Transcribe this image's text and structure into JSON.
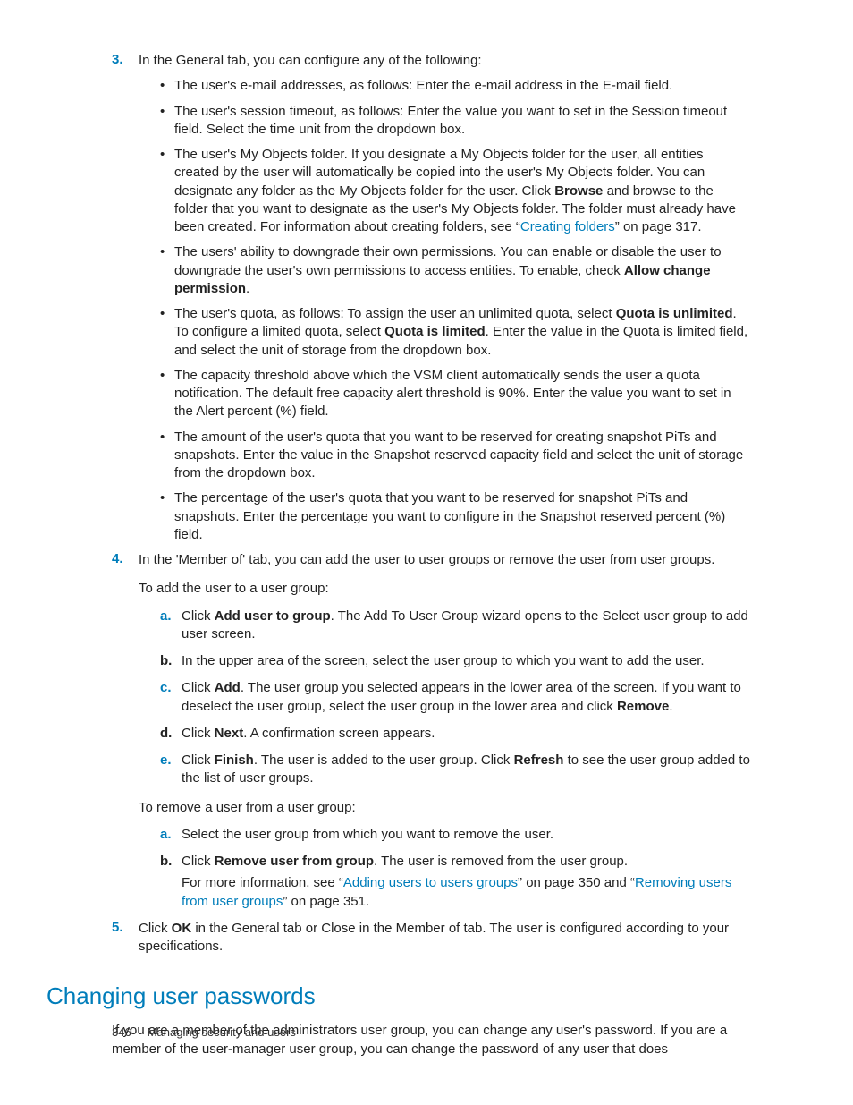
{
  "step3": {
    "num": "3.",
    "intro": "In the General tab, you can configure any of the following:",
    "bullets": {
      "b1": "The user's e-mail addresses, as follows: Enter the e-mail address in the E-mail field.",
      "b2": "The user's session timeout, as follows: Enter the value you want to set in the Session timeout field. Select the time unit from the dropdown box.",
      "b3_pre": "The user's My Objects folder. If you designate a My Objects folder for the user, all entities created by the user will automatically be copied into the user's My Objects folder. You can designate any folder as the My Objects folder for the user. Click ",
      "b3_bold1": "Browse",
      "b3_mid": " and browse to the folder that you want to designate as the user's My Objects folder. The folder must already have been created. For information about creating folders, see “",
      "b3_link": "Creating folders",
      "b3_post": "” on page 317.",
      "b4_pre": "The users' ability to downgrade their own permissions. You can enable or disable the user to downgrade the user's own permissions to access entities. To enable, check ",
      "b4_bold": "Allow change permission",
      "b4_post": ".",
      "b5_pre": "The user's quota, as follows: To assign the user an unlimited quota, select ",
      "b5_bold1": "Quota is unlimited",
      "b5_mid": ". To configure a limited quota, select ",
      "b5_bold2": "Quota is limited",
      "b5_post": ". Enter the value in the Quota is limited field, and select the unit of storage from the dropdown box.",
      "b6": "The capacity threshold above which the VSM client automatically sends the user a quota notification. The default free capacity alert threshold is 90%. Enter the value you want to set in the Alert percent (%) field.",
      "b7": "The amount of the user's quota that you want to be reserved for creating snapshot PiTs and snapshots. Enter the value in the Snapshot reserved capacity field and select the unit of storage from the dropdown box.",
      "b8": "The percentage of the user's quota that you want to be reserved for snapshot PiTs and snapshots. Enter the percentage you want to configure in the Snapshot reserved percent (%) field."
    }
  },
  "step4": {
    "num": "4.",
    "intro": "In the 'Member of' tab, you can add the user to user groups or remove the user from user groups.",
    "add_intro": "To add the user to a user group:",
    "add": {
      "a_pre": "Click ",
      "a_bold": "Add user to group",
      "a_post": ". The Add To User Group wizard opens to the Select user group to add user screen.",
      "b": "In the upper area of the screen, select the user group to which you want to add the user.",
      "c_pre": "Click ",
      "c_bold1": "Add",
      "c_mid": ". The user group you selected appears in the lower area of the screen. If you want to deselect the user group, select the user group in the lower area and click ",
      "c_bold2": "Remove",
      "c_post": ".",
      "d_pre": "Click ",
      "d_bold": "Next",
      "d_post": ". A confirmation screen appears.",
      "e_pre": "Click ",
      "e_bold1": "Finish",
      "e_mid": ". The user is added to the user group. Click ",
      "e_bold2": "Refresh",
      "e_post": " to see the user group added to the list of user groups."
    },
    "remove_intro": "To remove a user from a user group:",
    "remove": {
      "a": "Select the user group from which you want to remove the user.",
      "b_pre": "Click ",
      "b_bold": "Remove user from group",
      "b_post": ". The user is removed from the user group.",
      "b_more_pre": "For more information, see “",
      "b_link1": "Adding users to users groups",
      "b_more_mid": "” on page 350 and “",
      "b_link2": "Removing users from user groups",
      "b_more_post": "” on page 351."
    }
  },
  "step5": {
    "num": "5.",
    "text_pre": "Click ",
    "text_bold": "OK",
    "text_post": " in the General tab or Close in the Member of tab. The user is configured according to your specifications."
  },
  "section": {
    "title": "Changing user passwords",
    "body": "If you are a member of the administrators user group, you can change any user's password. If you are a member of the user-manager user group, you can change the password of any user that does"
  },
  "footer": {
    "page": "346",
    "chapter": "Managing security and users"
  },
  "letters": {
    "a": "a.",
    "b": "b.",
    "c": "c.",
    "d": "d.",
    "e": "e."
  }
}
